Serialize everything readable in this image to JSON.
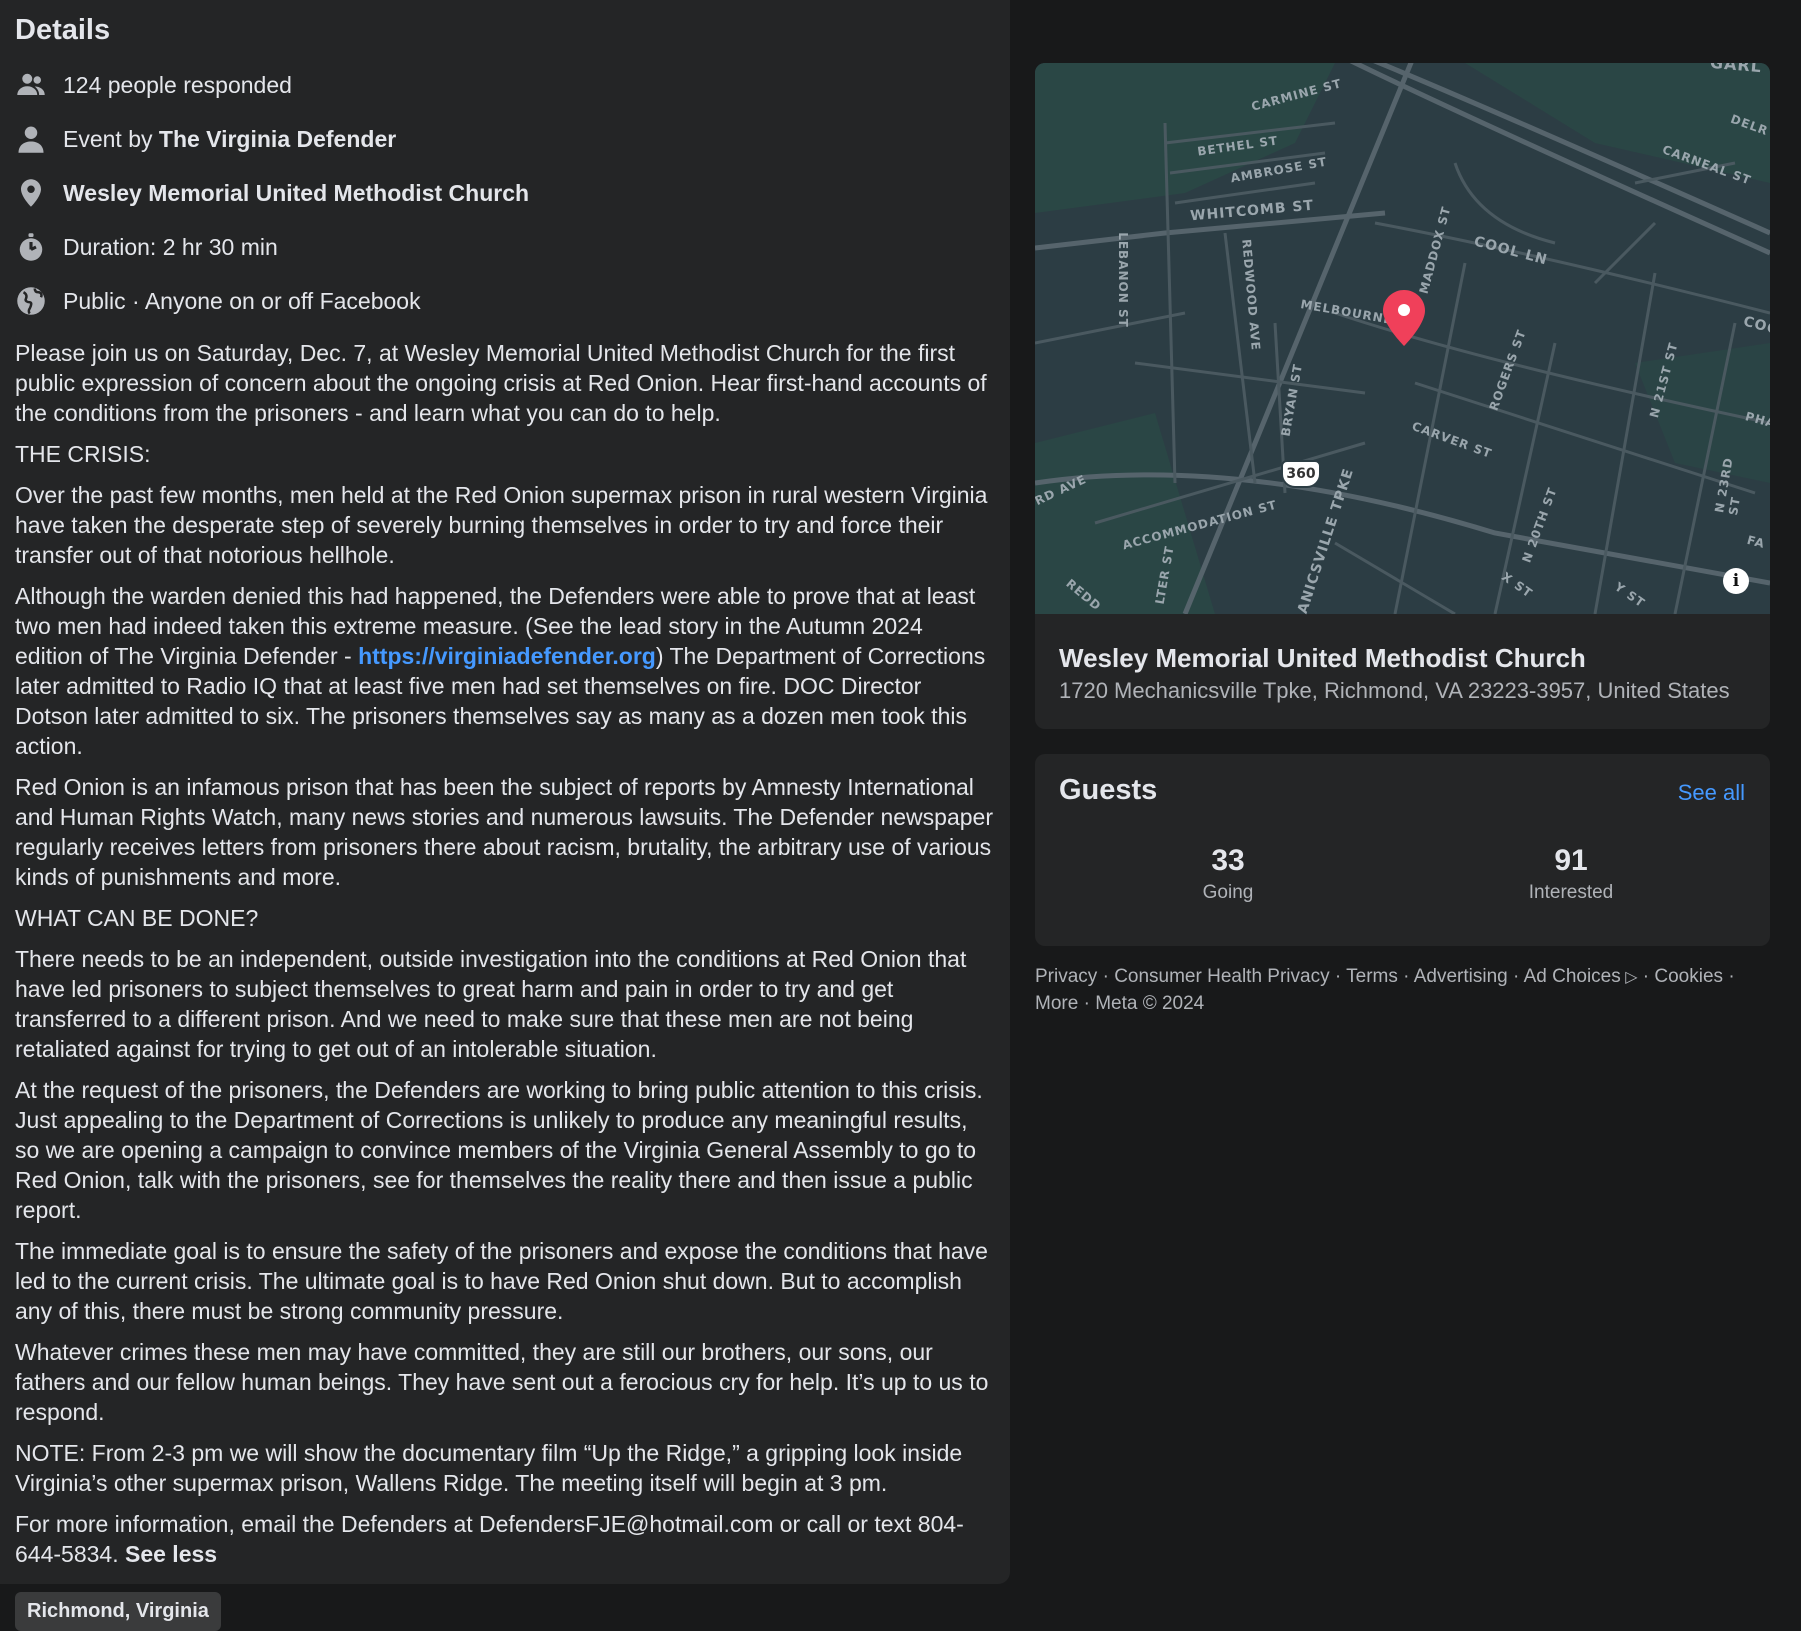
{
  "details": {
    "title": "Details",
    "responded": "124 people responded",
    "event_by_prefix": "Event by ",
    "event_by_name": "The Virginia Defender",
    "location": "Wesley Memorial United Methodist Church",
    "duration": "Duration: 2 hr 30 min",
    "privacy": "Public · Anyone on or off Facebook"
  },
  "description": {
    "p1": "Please join us on Saturday, Dec. 7, at Wesley Memorial United Methodist Church for the first public expression of concern about the ongoing crisis at Red Onion. Hear first-hand accounts of the conditions from the prisoners - and learn what you can do to help.",
    "p2": "THE CRISIS:",
    "p3": "Over the past few months, men held at the Red Onion supermax prison in rural western Virginia have taken the desperate step of severely burning themselves in order to try and force their transfer out of that notorious hellhole.",
    "p4a": "Although the warden denied this had happened, the Defenders were able to prove that at least two men had indeed taken this extreme measure. (See the lead story in the Autumn 2024 edition of The Virginia Defender - ",
    "p4link": "https://virginiadefender.org",
    "p4b": ") The Department of Corrections later admitted to Radio IQ that at least five men had set themselves on fire. DOC Director Dotson later admitted to six. The prisoners themselves say as many as a dozen men took this action.",
    "p5": "Red Onion is an infamous prison that has been the subject of reports by Amnesty International and Human Rights Watch, many news stories and numerous lawsuits. The Defender newspaper regularly receives letters from prisoners there about racism, brutality, the arbitrary use of various kinds of punishments and more.",
    "p6": "WHAT CAN BE DONE?",
    "p7": "There needs to be an independent, outside investigation into the conditions at Red Onion that have led prisoners to subject themselves to great harm and pain in order to try and get transferred to a different prison. And we need to make sure that these men are not being retaliated against for trying to get out of an intolerable situation.",
    "p8": "At the request of the prisoners, the Defenders are working to bring public attention to this crisis. Just appealing to the Department of Corrections is unlikely to produce any meaningful results, so we are opening a campaign to convince members of the Virginia General Assembly to go to Red Onion, talk with the prisoners, see for themselves the reality there and then issue a public report.",
    "p9": "The immediate goal is to ensure the safety of the prisoners and expose the conditions that have led to the current crisis. The ultimate goal is to have Red Onion shut down. But to accomplish any of this, there must be strong community pressure.",
    "p10": "Whatever crimes these men may have committed, they are still our brothers, our sons, our fathers and our fellow human beings. They have sent out a ferocious cry for help. It’s up to us to respond.",
    "p11": "NOTE: From 2-3 pm we will show the documentary film “Up the Ridge,” a gripping look inside Virginia’s other supermax prison, Wallens Ridge. The meeting itself will begin at 3 pm.",
    "p12": "For more information, email the Defenders at DefendersFJE@hotmail.com or call or text 804-644-5834. ",
    "see_less": "See less"
  },
  "tag": "Richmond, Virginia",
  "map": {
    "streets": [
      "CARMINE ST",
      "BETHEL ST",
      "AMBROSE ST",
      "WHITCOMB ST",
      "COOL LN",
      "CARNEAL ST",
      "MELBOURNE",
      "LEBANON ST",
      "REDWOOD AVE",
      "BRYAN ST",
      "ROGERS ST",
      "CARVER ST",
      "ACCOMMODATION ST",
      "N 21ST ST",
      "N 23RD ST",
      "N 20TH ST",
      "X ST",
      "Y ST",
      "RD AVE",
      "ANICSVILLE TPKE",
      "MADDOX ST",
      "DELR",
      "COO",
      "PHA",
      "FA",
      "GARL",
      "REDD",
      "LTER ST"
    ],
    "route_shield": "360",
    "info_icon": "info-icon",
    "pin_icon": "map-pin-icon"
  },
  "venue": {
    "name": "Wesley Memorial United Methodist Church",
    "address": "1720 Mechanicsville Tpke, Richmond, VA 23223-3957, United States"
  },
  "guests": {
    "title": "Guests",
    "see_all": "See all",
    "going_count": "33",
    "going_label": "Going",
    "interested_count": "91",
    "interested_label": "Interested"
  },
  "footer": {
    "privacy": "Privacy",
    "consumer_health": "Consumer Health Privacy",
    "terms": "Terms",
    "advertising": "Advertising",
    "ad_choices": "Ad Choices",
    "cookies": "Cookies",
    "more": "More",
    "meta": "Meta © 2024"
  },
  "colors": {
    "page_bg": "#18191a",
    "card_bg": "#242526",
    "link": "#4599ff",
    "pin": "#f0405a",
    "map_bg": "#2b3a41"
  }
}
